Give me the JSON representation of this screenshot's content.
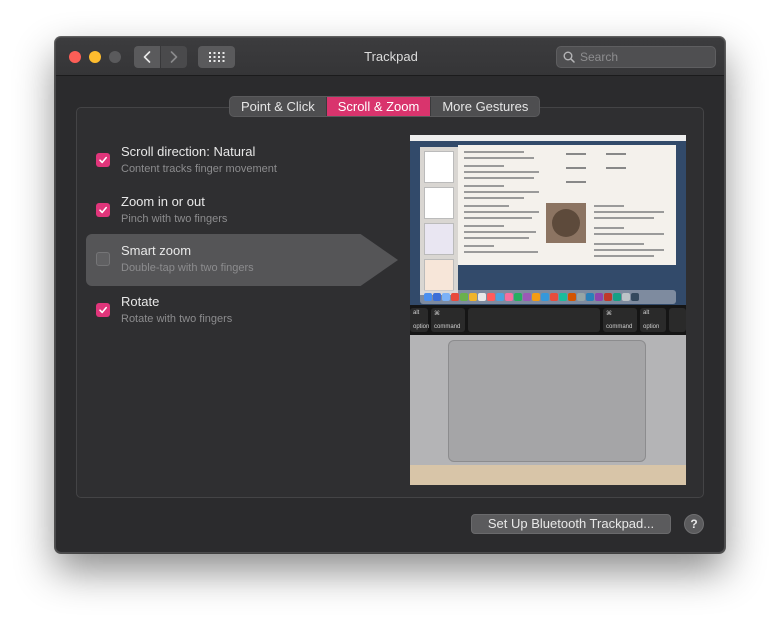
{
  "window": {
    "title": "Trackpad",
    "search_placeholder": "Search"
  },
  "tabs": [
    {
      "label": "Point & Click",
      "active": false
    },
    {
      "label": "Scroll & Zoom",
      "active": true
    },
    {
      "label": "More Gestures",
      "active": false
    }
  ],
  "options": [
    {
      "title": "Scroll direction: Natural",
      "subtitle": "Content tracks finger movement",
      "checked": true
    },
    {
      "title": "Zoom in or out",
      "subtitle": "Pinch with two fingers",
      "checked": true
    },
    {
      "title": "Smart zoom",
      "subtitle": "Double-tap with two fingers",
      "checked": false,
      "selected": true
    },
    {
      "title": "Rotate",
      "subtitle": "Rotate with two fingers",
      "checked": true
    }
  ],
  "preview": {
    "touchbar_keys": [
      "option",
      "command",
      "command",
      "option"
    ]
  },
  "footer": {
    "setup_label": "Set Up Bluetooth Trackpad...",
    "help_label": "?"
  },
  "colors": {
    "accent": "#d9346d",
    "checkbox_on": "#e0357a",
    "window_bg": "#2b2b2d"
  },
  "icons": {
    "back": "chevron-left-icon",
    "forward": "chevron-right-icon",
    "grid": "grid-icon",
    "search": "search-icon",
    "check": "checkmark-icon"
  }
}
